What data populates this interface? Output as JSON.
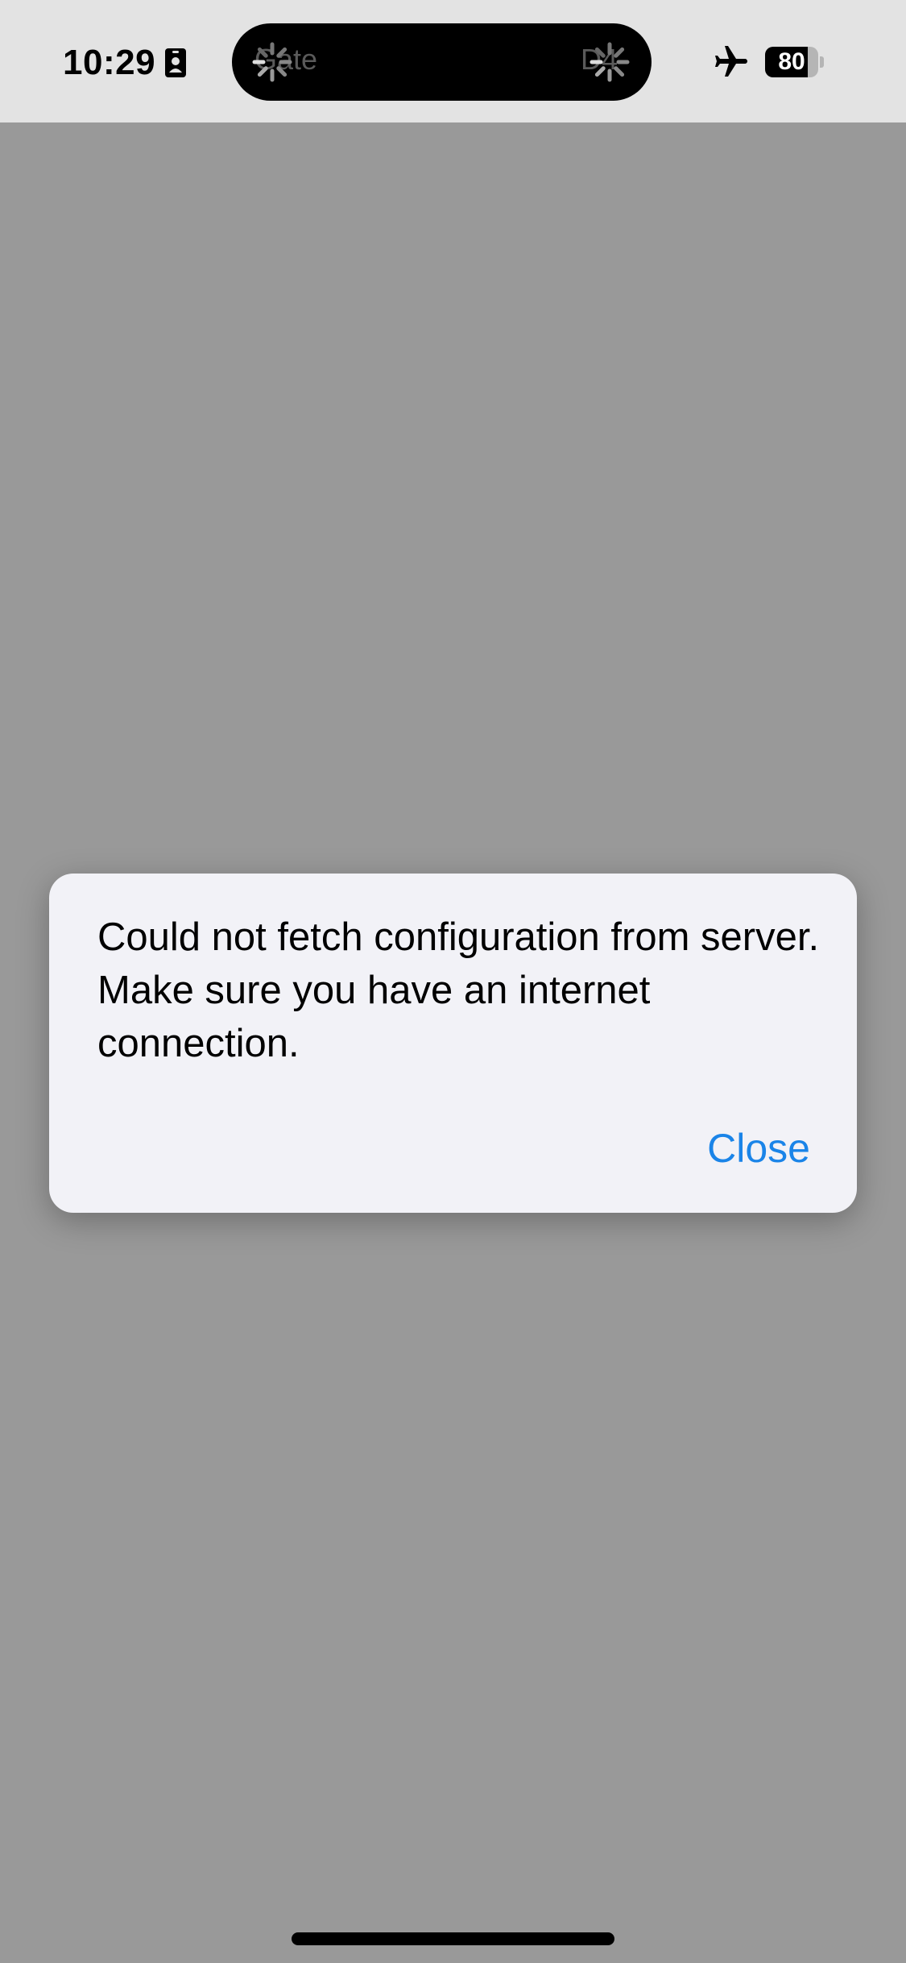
{
  "status_bar": {
    "time": "10:29",
    "island_left_text": "Gate",
    "island_right_text": "D4",
    "battery_level": 80,
    "battery_label": "80",
    "airplane_mode": true,
    "icons": [
      "id-badge-icon",
      "loading-spinner-icon",
      "airplane-icon",
      "battery-icon"
    ]
  },
  "dialog": {
    "message": "Could not fetch configuration from server. Make sure you have an internet connection.",
    "close_label": "Close"
  },
  "colors": {
    "background_dim": "#999999",
    "status_bar_bg": "#e3e3e3",
    "dialog_bg": "#f2f2f7",
    "accent": "#1a84e8"
  }
}
